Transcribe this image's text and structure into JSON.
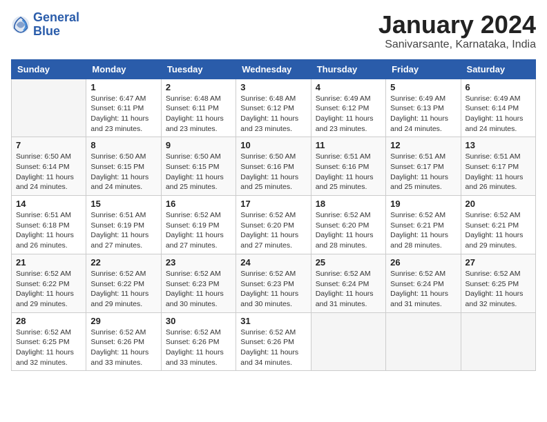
{
  "header": {
    "logo_line1": "General",
    "logo_line2": "Blue",
    "title": "January 2024",
    "subtitle": "Sanivarsante, Karnataka, India"
  },
  "weekdays": [
    "Sunday",
    "Monday",
    "Tuesday",
    "Wednesday",
    "Thursday",
    "Friday",
    "Saturday"
  ],
  "weeks": [
    [
      {
        "day": "",
        "sunrise": "",
        "sunset": "",
        "daylight": ""
      },
      {
        "day": "1",
        "sunrise": "Sunrise: 6:47 AM",
        "sunset": "Sunset: 6:11 PM",
        "daylight": "Daylight: 11 hours and 23 minutes."
      },
      {
        "day": "2",
        "sunrise": "Sunrise: 6:48 AM",
        "sunset": "Sunset: 6:11 PM",
        "daylight": "Daylight: 11 hours and 23 minutes."
      },
      {
        "day": "3",
        "sunrise": "Sunrise: 6:48 AM",
        "sunset": "Sunset: 6:12 PM",
        "daylight": "Daylight: 11 hours and 23 minutes."
      },
      {
        "day": "4",
        "sunrise": "Sunrise: 6:49 AM",
        "sunset": "Sunset: 6:12 PM",
        "daylight": "Daylight: 11 hours and 23 minutes."
      },
      {
        "day": "5",
        "sunrise": "Sunrise: 6:49 AM",
        "sunset": "Sunset: 6:13 PM",
        "daylight": "Daylight: 11 hours and 24 minutes."
      },
      {
        "day": "6",
        "sunrise": "Sunrise: 6:49 AM",
        "sunset": "Sunset: 6:14 PM",
        "daylight": "Daylight: 11 hours and 24 minutes."
      }
    ],
    [
      {
        "day": "7",
        "sunrise": "Sunrise: 6:50 AM",
        "sunset": "Sunset: 6:14 PM",
        "daylight": "Daylight: 11 hours and 24 minutes."
      },
      {
        "day": "8",
        "sunrise": "Sunrise: 6:50 AM",
        "sunset": "Sunset: 6:15 PM",
        "daylight": "Daylight: 11 hours and 24 minutes."
      },
      {
        "day": "9",
        "sunrise": "Sunrise: 6:50 AM",
        "sunset": "Sunset: 6:15 PM",
        "daylight": "Daylight: 11 hours and 25 minutes."
      },
      {
        "day": "10",
        "sunrise": "Sunrise: 6:50 AM",
        "sunset": "Sunset: 6:16 PM",
        "daylight": "Daylight: 11 hours and 25 minutes."
      },
      {
        "day": "11",
        "sunrise": "Sunrise: 6:51 AM",
        "sunset": "Sunset: 6:16 PM",
        "daylight": "Daylight: 11 hours and 25 minutes."
      },
      {
        "day": "12",
        "sunrise": "Sunrise: 6:51 AM",
        "sunset": "Sunset: 6:17 PM",
        "daylight": "Daylight: 11 hours and 25 minutes."
      },
      {
        "day": "13",
        "sunrise": "Sunrise: 6:51 AM",
        "sunset": "Sunset: 6:17 PM",
        "daylight": "Daylight: 11 hours and 26 minutes."
      }
    ],
    [
      {
        "day": "14",
        "sunrise": "Sunrise: 6:51 AM",
        "sunset": "Sunset: 6:18 PM",
        "daylight": "Daylight: 11 hours and 26 minutes."
      },
      {
        "day": "15",
        "sunrise": "Sunrise: 6:51 AM",
        "sunset": "Sunset: 6:19 PM",
        "daylight": "Daylight: 11 hours and 27 minutes."
      },
      {
        "day": "16",
        "sunrise": "Sunrise: 6:52 AM",
        "sunset": "Sunset: 6:19 PM",
        "daylight": "Daylight: 11 hours and 27 minutes."
      },
      {
        "day": "17",
        "sunrise": "Sunrise: 6:52 AM",
        "sunset": "Sunset: 6:20 PM",
        "daylight": "Daylight: 11 hours and 27 minutes."
      },
      {
        "day": "18",
        "sunrise": "Sunrise: 6:52 AM",
        "sunset": "Sunset: 6:20 PM",
        "daylight": "Daylight: 11 hours and 28 minutes."
      },
      {
        "day": "19",
        "sunrise": "Sunrise: 6:52 AM",
        "sunset": "Sunset: 6:21 PM",
        "daylight": "Daylight: 11 hours and 28 minutes."
      },
      {
        "day": "20",
        "sunrise": "Sunrise: 6:52 AM",
        "sunset": "Sunset: 6:21 PM",
        "daylight": "Daylight: 11 hours and 29 minutes."
      }
    ],
    [
      {
        "day": "21",
        "sunrise": "Sunrise: 6:52 AM",
        "sunset": "Sunset: 6:22 PM",
        "daylight": "Daylight: 11 hours and 29 minutes."
      },
      {
        "day": "22",
        "sunrise": "Sunrise: 6:52 AM",
        "sunset": "Sunset: 6:22 PM",
        "daylight": "Daylight: 11 hours and 29 minutes."
      },
      {
        "day": "23",
        "sunrise": "Sunrise: 6:52 AM",
        "sunset": "Sunset: 6:23 PM",
        "daylight": "Daylight: 11 hours and 30 minutes."
      },
      {
        "day": "24",
        "sunrise": "Sunrise: 6:52 AM",
        "sunset": "Sunset: 6:23 PM",
        "daylight": "Daylight: 11 hours and 30 minutes."
      },
      {
        "day": "25",
        "sunrise": "Sunrise: 6:52 AM",
        "sunset": "Sunset: 6:24 PM",
        "daylight": "Daylight: 11 hours and 31 minutes."
      },
      {
        "day": "26",
        "sunrise": "Sunrise: 6:52 AM",
        "sunset": "Sunset: 6:24 PM",
        "daylight": "Daylight: 11 hours and 31 minutes."
      },
      {
        "day": "27",
        "sunrise": "Sunrise: 6:52 AM",
        "sunset": "Sunset: 6:25 PM",
        "daylight": "Daylight: 11 hours and 32 minutes."
      }
    ],
    [
      {
        "day": "28",
        "sunrise": "Sunrise: 6:52 AM",
        "sunset": "Sunset: 6:25 PM",
        "daylight": "Daylight: 11 hours and 32 minutes."
      },
      {
        "day": "29",
        "sunrise": "Sunrise: 6:52 AM",
        "sunset": "Sunset: 6:26 PM",
        "daylight": "Daylight: 11 hours and 33 minutes."
      },
      {
        "day": "30",
        "sunrise": "Sunrise: 6:52 AM",
        "sunset": "Sunset: 6:26 PM",
        "daylight": "Daylight: 11 hours and 33 minutes."
      },
      {
        "day": "31",
        "sunrise": "Sunrise: 6:52 AM",
        "sunset": "Sunset: 6:26 PM",
        "daylight": "Daylight: 11 hours and 34 minutes."
      },
      {
        "day": "",
        "sunrise": "",
        "sunset": "",
        "daylight": ""
      },
      {
        "day": "",
        "sunrise": "",
        "sunset": "",
        "daylight": ""
      },
      {
        "day": "",
        "sunrise": "",
        "sunset": "",
        "daylight": ""
      }
    ]
  ]
}
